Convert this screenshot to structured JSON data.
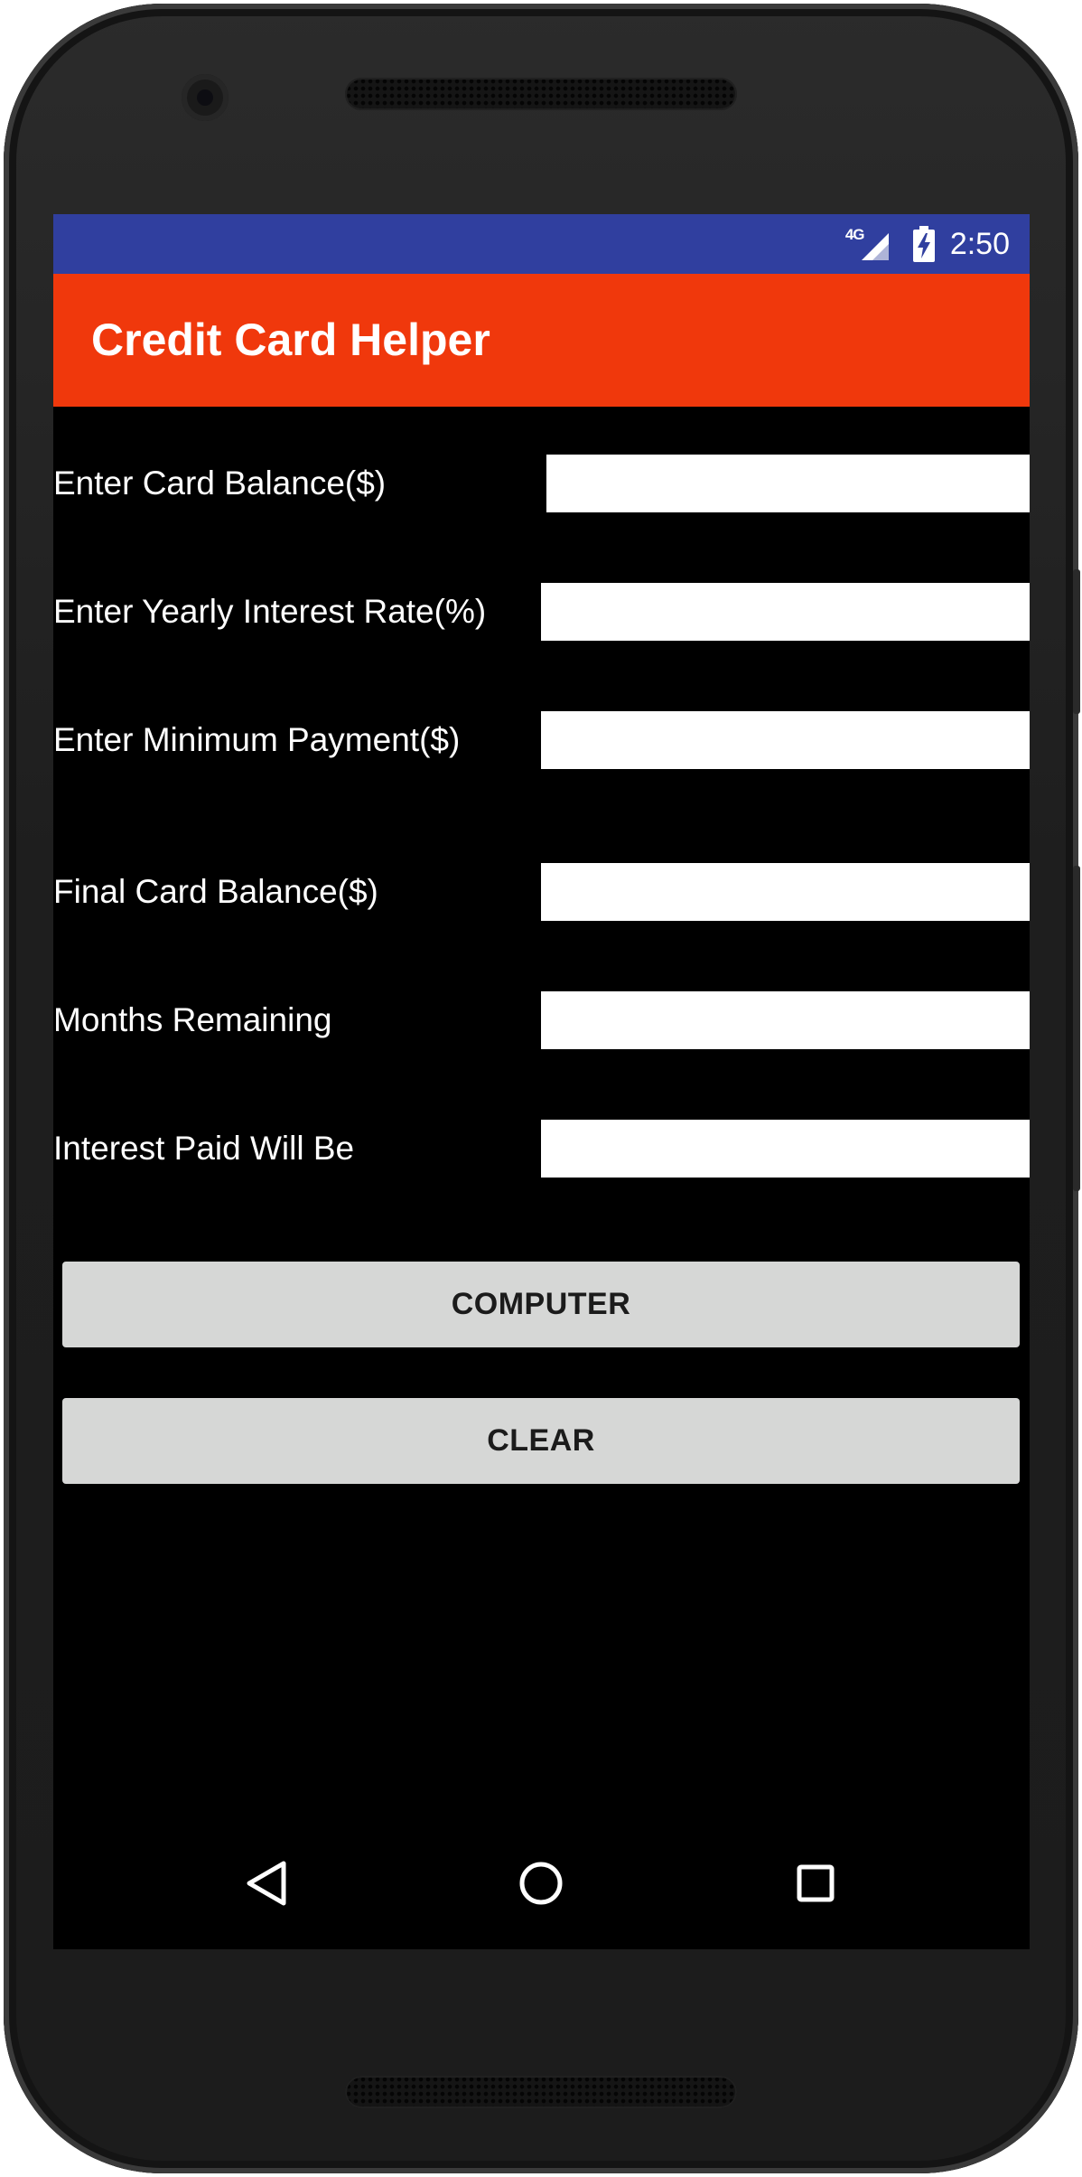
{
  "status_bar": {
    "network": "4G",
    "time": "2:50",
    "icons": [
      "signal-icon",
      "battery-charging-icon"
    ]
  },
  "app_bar": {
    "title": "Credit Card Helper"
  },
  "form": {
    "card_balance": {
      "label": "Enter Card Balance($)",
      "value": ""
    },
    "interest_rate": {
      "label": "Enter Yearly Interest Rate(%)",
      "value": ""
    },
    "minimum_payment": {
      "label": "Enter Minimum Payment($)",
      "value": ""
    },
    "final_balance": {
      "label": "Final Card Balance($)",
      "value": ""
    },
    "months_remaining": {
      "label": "Months Remaining",
      "value": ""
    },
    "interest_paid": {
      "label": "Interest Paid Will Be",
      "value": ""
    }
  },
  "buttons": {
    "compute_label": "COMPUTER",
    "clear_label": "CLEAR"
  },
  "nav_bar": {
    "icons": [
      "back-icon",
      "home-icon",
      "recents-icon"
    ]
  },
  "colors": {
    "status_bar": "#303f9f",
    "app_bar": "#f0380c",
    "screen_background": "#000000",
    "button_background": "#d6d7d6"
  }
}
